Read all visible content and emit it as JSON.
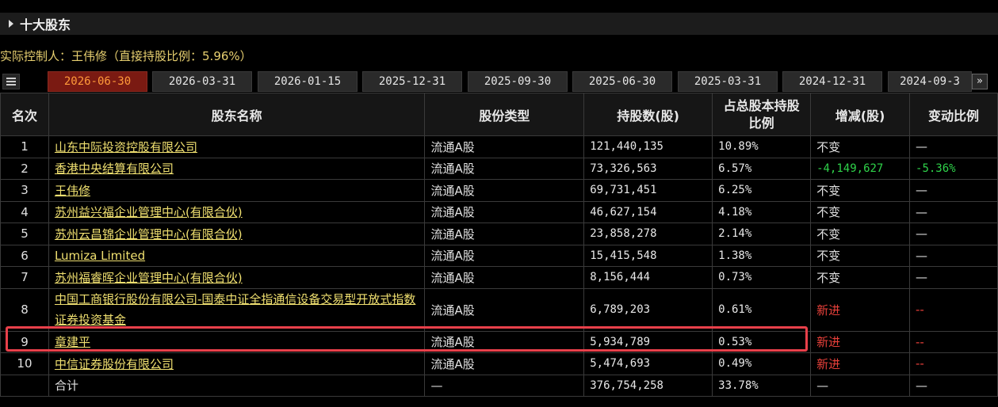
{
  "section": {
    "title": "十大股东"
  },
  "controller_line": "实际控制人：王伟修（直接持股比例：5.96%）",
  "tabs": [
    "2026-06-30",
    "2026-03-31",
    "2026-01-15",
    "2025-12-31",
    "2025-09-30",
    "2025-06-30",
    "2025-03-31",
    "2024-12-31",
    "2024-09-3"
  ],
  "active_tab": "2026-06-30",
  "next_glyph": "»",
  "table": {
    "headers": {
      "rank": "名次",
      "name": "股东名称",
      "type": "股份类型",
      "shares": "持股数(股)",
      "ratio_line1": "占总股本持股",
      "ratio_line2": "比例",
      "change": "增减(股)",
      "change_ratio": "变动比例"
    },
    "rows": [
      {
        "rank": "1",
        "name": "山东中际投资控股有限公司",
        "type": "流通A股",
        "shares": "121,440,135",
        "ratio": "10.89%",
        "change": "不变",
        "change_ratio": "—"
      },
      {
        "rank": "2",
        "name": "香港中央结算有限公司",
        "type": "流通A股",
        "shares": "73,326,563",
        "ratio": "6.57%",
        "change": "-4,149,627",
        "change_ratio": "-5.36%"
      },
      {
        "rank": "3",
        "name": "王伟修",
        "type": "流通A股",
        "shares": "69,731,451",
        "ratio": "6.25%",
        "change": "不变",
        "change_ratio": "—"
      },
      {
        "rank": "4",
        "name": "苏州益兴福企业管理中心(有限合伙)",
        "type": "流通A股",
        "shares": "46,627,154",
        "ratio": "4.18%",
        "change": "不变",
        "change_ratio": "—"
      },
      {
        "rank": "5",
        "name": "苏州云昌锦企业管理中心(有限合伙)",
        "type": "流通A股",
        "shares": "23,858,278",
        "ratio": "2.14%",
        "change": "不变",
        "change_ratio": "—"
      },
      {
        "rank": "6",
        "name": "Lumiza Limited",
        "type": "流通A股",
        "shares": "15,415,548",
        "ratio": "1.38%",
        "change": "不变",
        "change_ratio": "—"
      },
      {
        "rank": "7",
        "name": "苏州福睿晖企业管理中心(有限合伙)",
        "type": "流通A股",
        "shares": "8,156,444",
        "ratio": "0.73%",
        "change": "不变",
        "change_ratio": "—"
      },
      {
        "rank": "8",
        "name": "中国工商银行股份有限公司-国泰中证全指通信设备交易型开放式指数证券投资基金",
        "type": "流通A股",
        "shares": "6,789,203",
        "ratio": "0.61%",
        "change": "新进",
        "change_ratio": "--"
      },
      {
        "rank": "9",
        "name": "章建平",
        "type": "流通A股",
        "shares": "5,934,789",
        "ratio": "0.53%",
        "change": "新进",
        "change_ratio": "--"
      },
      {
        "rank": "10",
        "name": "中信证券股份有限公司",
        "type": "流通A股",
        "shares": "5,474,693",
        "ratio": "0.49%",
        "change": "新进",
        "change_ratio": "--"
      }
    ],
    "total": {
      "label": "合计",
      "type": "—",
      "shares": "376,754,258",
      "ratio": "33.78%",
      "change": "—",
      "change_ratio": "—"
    }
  },
  "colors": {
    "link": "#f0e070",
    "new": "#e8403a",
    "decrease": "#2fd34a",
    "highlight": "#e8404a",
    "active_tab_bg": "#7a1a12"
  }
}
